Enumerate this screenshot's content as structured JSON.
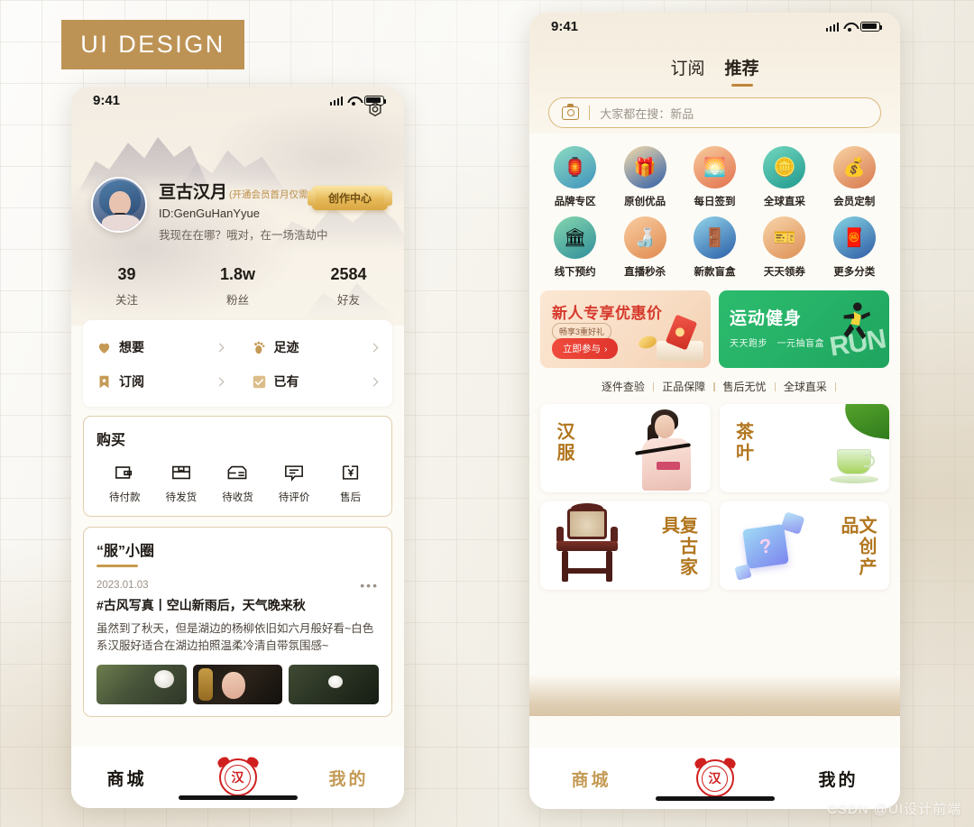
{
  "badge": {
    "label": "UI DESIGN",
    "color": "#bd9355"
  },
  "watermark": "CSDN @UI设计前端",
  "left_phone": {
    "statusbar": {
      "time": "9:41"
    },
    "settings_icon": "gear-icon",
    "profile": {
      "name": "亘古汉月",
      "vip_tag": "(开通会员首月仅需1元)",
      "id": "ID:GenGuHanYyue",
      "bio": "我现在在哪？哦对，在一场浩劫中",
      "create_center_button": "创作中心"
    },
    "stats": [
      {
        "value": "39",
        "label": "关注"
      },
      {
        "value": "1.8w",
        "label": "粉丝"
      },
      {
        "value": "2584",
        "label": "好友"
      }
    ],
    "quick_links": [
      {
        "label": "想要",
        "icon": "heart-icon"
      },
      {
        "label": "足迹",
        "icon": "footprint-icon"
      },
      {
        "label": "订阅",
        "icon": "bookmark-star-icon"
      },
      {
        "label": "已有",
        "icon": "checkbox-icon"
      }
    ],
    "purchase": {
      "title": "购买",
      "items": [
        {
          "label": "待付款",
          "icon": "wallet-icon"
        },
        {
          "label": "待发货",
          "icon": "package-icon"
        },
        {
          "label": "待收货",
          "icon": "delivery-icon"
        },
        {
          "label": "待评价",
          "icon": "comment-icon"
        },
        {
          "label": "售后",
          "icon": "refund-icon"
        }
      ]
    },
    "circle": {
      "title": "“服”小圈",
      "post": {
        "date": "2023.01.03",
        "more": "•••",
        "title": "#古风写真丨空山新雨后，天气晚来秋",
        "body": "虽然到了秋天，但是湖边的杨柳依旧如六月般好看~白色系汉服好适合在湖边拍照温柔冷清自带氛围感~",
        "thumbnails": [
          "flower-hair-photo",
          "portrait-photo",
          "nature-photo"
        ]
      }
    },
    "tabbar": [
      {
        "label": "商城",
        "state": "active",
        "color": "#17130f"
      },
      {
        "label": "seal-logo",
        "state": "logo"
      },
      {
        "label": "我的",
        "state": "inactive",
        "color": "#c49a55"
      }
    ]
  },
  "right_phone": {
    "statusbar": {
      "time": "9:41"
    },
    "tabs": [
      {
        "label": "订阅",
        "active": false
      },
      {
        "label": "推荐",
        "active": true
      }
    ],
    "search": {
      "placeholder": "大家都在搜：新品",
      "icon": "camera-icon"
    },
    "icon_grid": [
      {
        "label": "品牌专区",
        "glyph": "🏮",
        "bg1": "#7fd0b0",
        "bg2": "#3f8fb8"
      },
      {
        "label": "原创优品",
        "glyph": "🎁",
        "bg1": "#f3d9a8",
        "bg2": "#2f5fa8"
      },
      {
        "label": "每日签到",
        "glyph": "🌅",
        "bg1": "#f6c99a",
        "bg2": "#e2714d"
      },
      {
        "label": "全球直采",
        "glyph": "🪙",
        "bg1": "#6fd2bb",
        "bg2": "#1f9a8e"
      },
      {
        "label": "会员定制",
        "glyph": "💰",
        "bg1": "#f6cf9f",
        "bg2": "#d8784c"
      },
      {
        "label": "线下预约",
        "glyph": "🏛",
        "bg1": "#7fd0a8",
        "bg2": "#2f8f9a"
      },
      {
        "label": "直播秒杀",
        "glyph": "🍶",
        "bg1": "#f7c79b",
        "bg2": "#e08a4f"
      },
      {
        "label": "新款盲盒",
        "glyph": "🚪",
        "bg1": "#8fd0e8",
        "bg2": "#2a5ea8"
      },
      {
        "label": "天天领券",
        "glyph": "🎫",
        "bg1": "#f6cfa5",
        "bg2": "#dd9055"
      },
      {
        "label": "更多分类",
        "glyph": "🧧",
        "bg1": "#7fcfe0",
        "bg2": "#2f5ba5"
      }
    ],
    "banners": [
      {
        "title": "新人专享优惠价",
        "subtitle": "畅享3重好礼",
        "cta": "立即参与",
        "cta_arrow": "›"
      },
      {
        "title": "运动健身",
        "subtitle": "天天跑步　一元抽盲盒",
        "art_text": "RUN"
      }
    ],
    "guarantees": [
      "逐件查验",
      "正品保障",
      "售后无忧",
      "全球直采"
    ],
    "products": [
      {
        "title": "汉服",
        "art": "hanfu-model"
      },
      {
        "title": "茶叶",
        "art": "tea-cup"
      },
      {
        "title": "复古家具",
        "art": "vintage-chair"
      },
      {
        "title": "文创产品",
        "art": "blind-box"
      }
    ],
    "tabbar": [
      {
        "label": "商城",
        "state": "inactive",
        "color": "#c49a55"
      },
      {
        "label": "seal-logo",
        "state": "logo"
      },
      {
        "label": "我的",
        "state": "active",
        "color": "#17130f"
      }
    ]
  }
}
